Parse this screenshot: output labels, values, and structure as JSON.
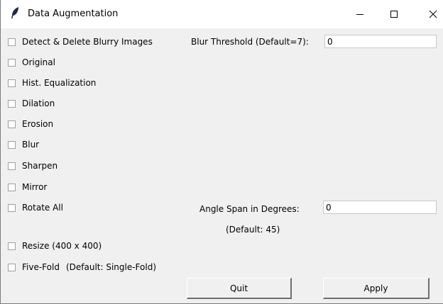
{
  "window": {
    "title": "Data Augmentation",
    "icon": "feather-icon"
  },
  "checkboxes": [
    {
      "label": "Detect & Delete Blurry Images",
      "checked": false
    },
    {
      "label": "Original",
      "checked": false
    },
    {
      "label": "Hist. Equalization",
      "checked": false
    },
    {
      "label": "Dilation",
      "checked": false
    },
    {
      "label": "Erosion",
      "checked": false
    },
    {
      "label": "Blur",
      "checked": false
    },
    {
      "label": "Sharpen",
      "checked": false
    },
    {
      "label": "Mirror",
      "checked": false
    },
    {
      "label": "Rotate All",
      "checked": false
    },
    {
      "label": "Resize (400 x 400)",
      "checked": false
    },
    {
      "label": "Five-Fold",
      "checked": false
    }
  ],
  "five_fold_note": "(Default: Single-Fold)",
  "blur_threshold": {
    "label": "Blur Threshold (Default=7):",
    "value": "0"
  },
  "angle_span": {
    "label": "Angle Span in Degrees:",
    "default_note": "(Default: 45)",
    "value": "0"
  },
  "buttons": {
    "quit": "Quit",
    "apply": "Apply"
  }
}
